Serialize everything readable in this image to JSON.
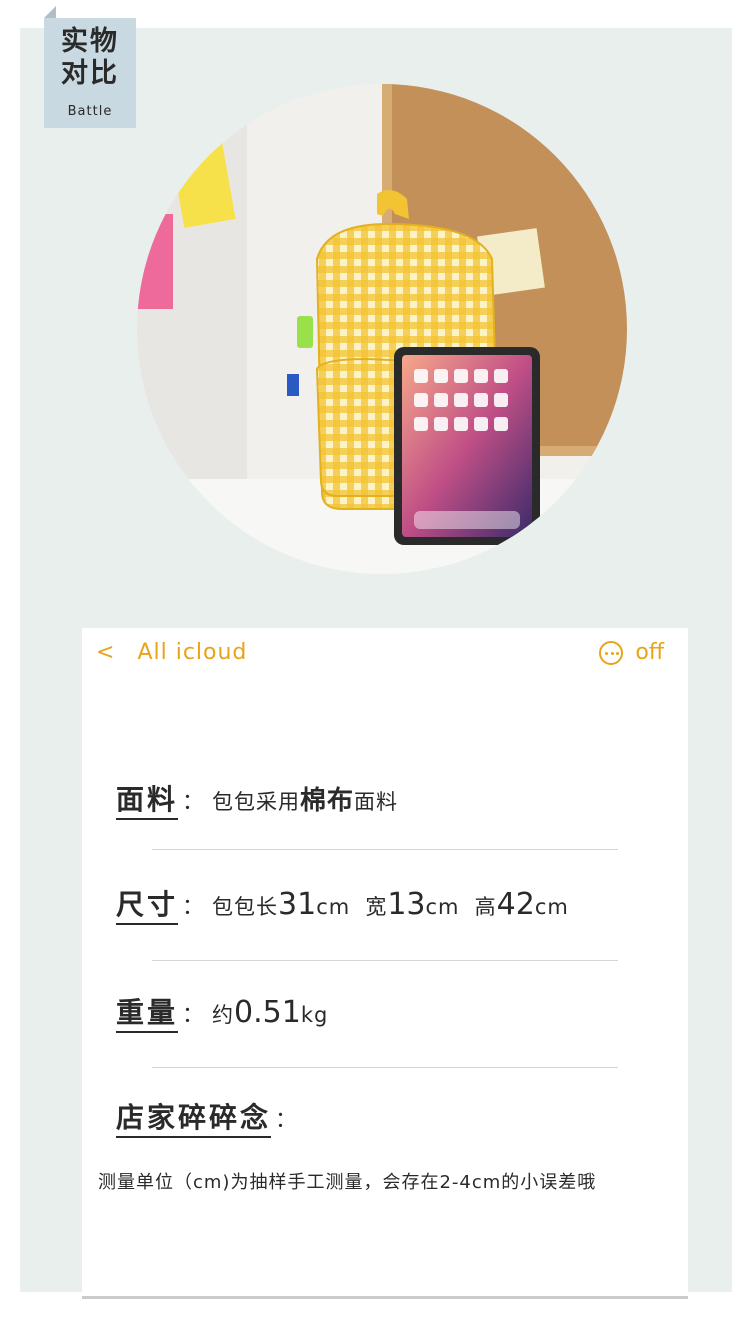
{
  "badge": {
    "line1": "实物",
    "line2": "对比",
    "sub": "Battle"
  },
  "photo": {
    "icon": "product-photo-backpack-with-tablet"
  },
  "nav": {
    "back_icon": "<",
    "back_label": "All icloud",
    "more_label": "off",
    "accent_color": "#e8a418"
  },
  "specs": {
    "material": {
      "label": "面料",
      "colon": "：",
      "text_a": "包包采用",
      "text_b": "棉布",
      "text_c": "面料"
    },
    "size": {
      "label": "尺寸",
      "colon": "：",
      "len_prefix": "包包长",
      "len_val": "31",
      "len_unit": "cm",
      "width_prefix": "宽",
      "width_val": "13",
      "width_unit": "cm",
      "height_prefix": "高",
      "height_val": "42",
      "height_unit": "cm"
    },
    "weight": {
      "label": "重量",
      "colon": "：",
      "prefix": "约",
      "val": "0.51",
      "unit": "kg"
    },
    "note": {
      "label": "店家碎碎念",
      "colon": "："
    }
  },
  "footnote": "测量单位（cm)为抽样手工测量，会存在2-4cm的小误差哦"
}
